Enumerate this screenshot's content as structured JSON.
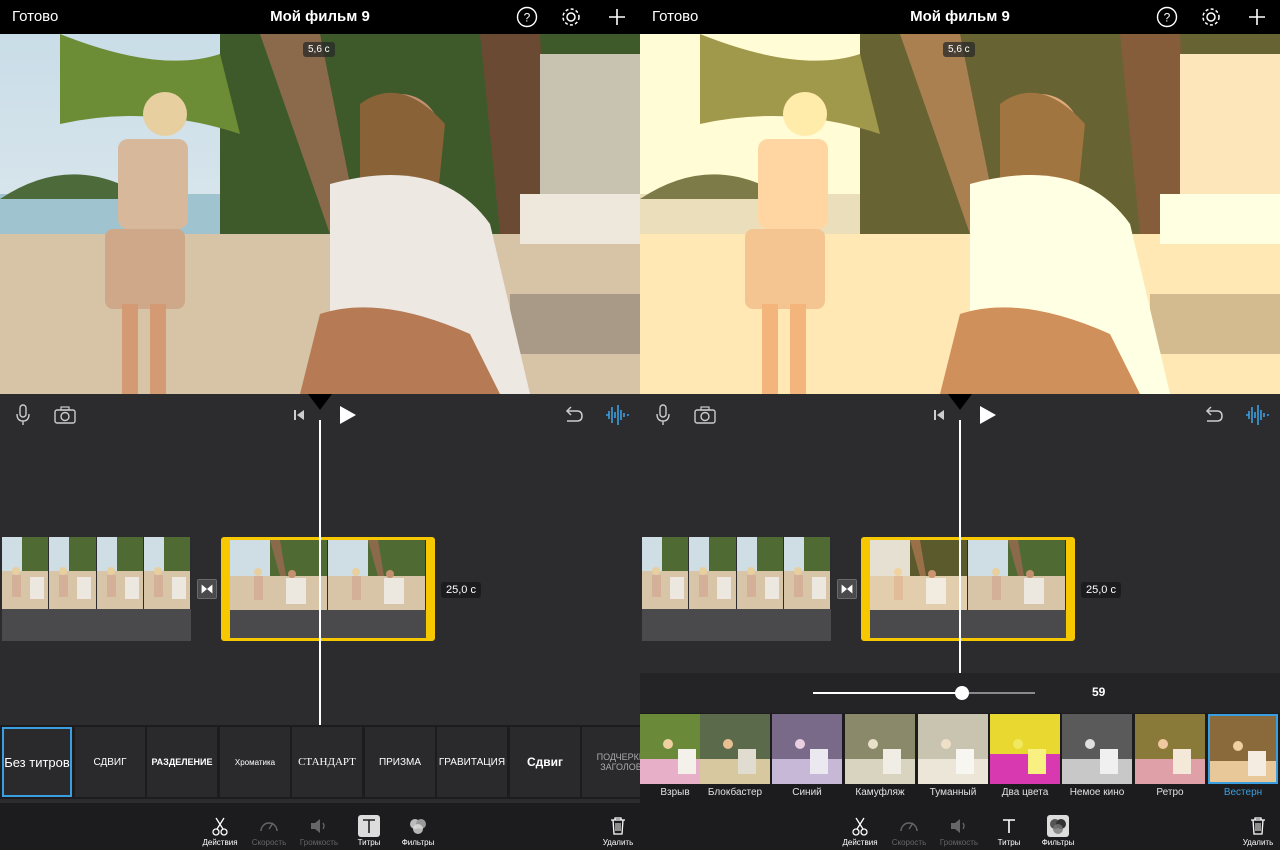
{
  "left": {
    "topbar": {
      "done": "Готово",
      "title": "Мой фильм 9"
    },
    "preview": {
      "duration": "5,6 с"
    },
    "timeline": {
      "clip_duration": "25,0 с"
    },
    "titles": [
      "Без титров",
      "СДВИГ",
      "РАЗДЕЛЕНИЕ",
      "Хроматика",
      "СТАНДАРТ",
      "ПРИЗМА",
      "ГРАВИТАЦИЯ",
      "Сдвиг",
      "ПОДЧЕРКН ЗАГОЛОВ"
    ],
    "toolbar": {
      "actions": "Действия",
      "speed": "Скорость",
      "volume": "Громкость",
      "titles": "Титры",
      "filters": "Фильтры",
      "delete": "Удалить"
    }
  },
  "right": {
    "topbar": {
      "done": "Готово",
      "title": "Мой фильм 9"
    },
    "preview": {
      "duration": "5,6 с"
    },
    "timeline": {
      "clip_duration": "25,0 с"
    },
    "slider": {
      "value": "59",
      "fraction": 0.67
    },
    "filters": [
      "Взрыв",
      "Блокбастер",
      "Синий",
      "Камуфляж",
      "Туманный",
      "Два цвета",
      "Немое кино",
      "Ретро",
      "Вестерн"
    ],
    "selected_filter": "Вестерн",
    "toolbar": {
      "actions": "Действия",
      "speed": "Скорость",
      "volume": "Громкость",
      "titles": "Титры",
      "filters": "Фильтры",
      "delete": "Удалить"
    }
  },
  "colors": {
    "accent": "#3a9fe0",
    "clip_border": "#f7c800",
    "background": "#2c2c2e"
  }
}
